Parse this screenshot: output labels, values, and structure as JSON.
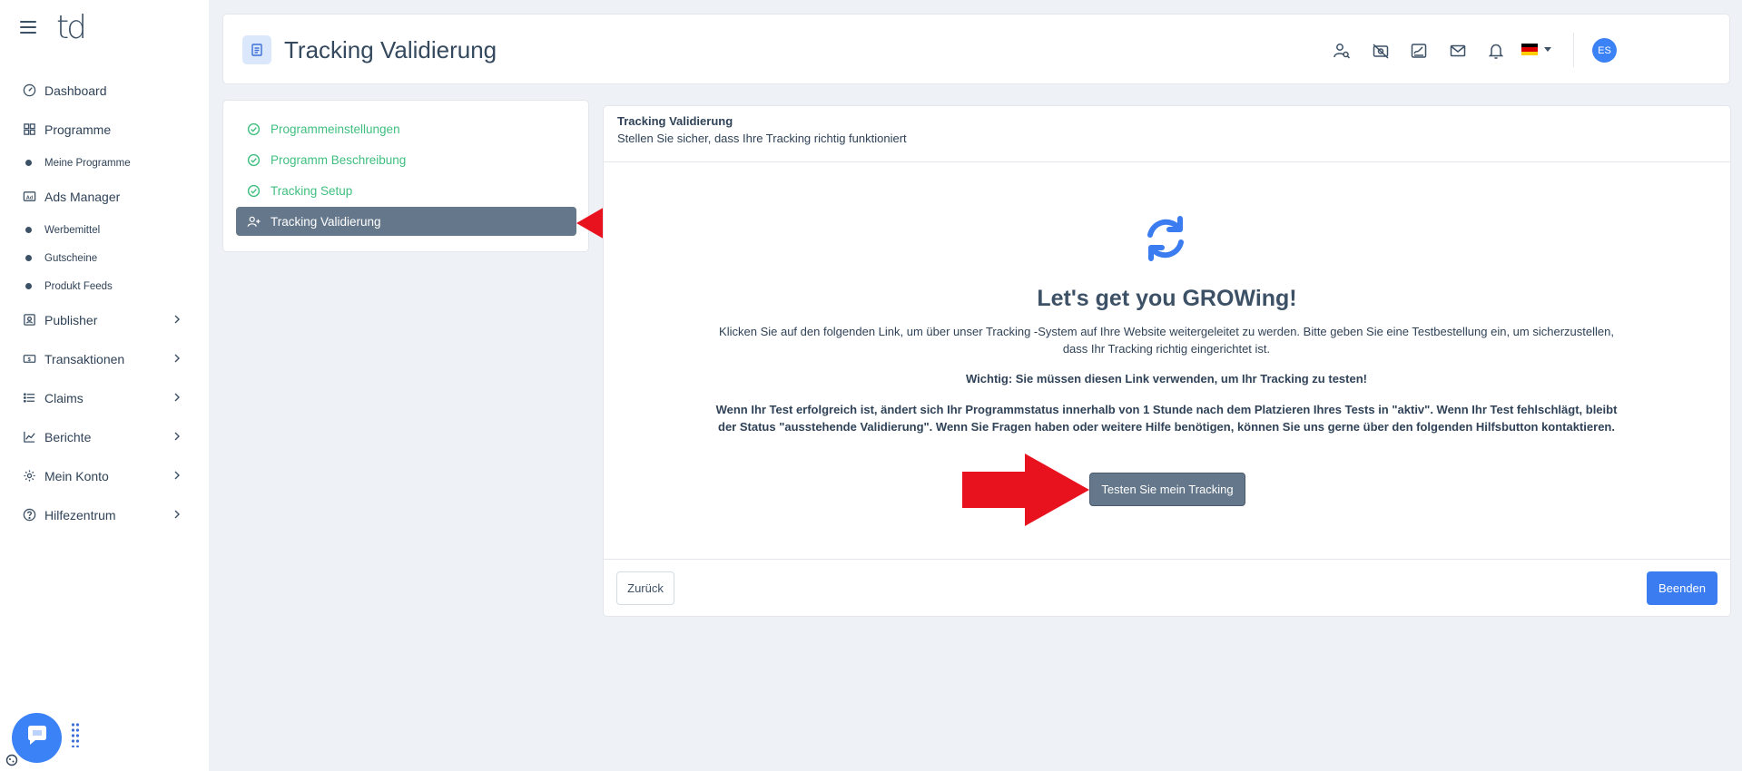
{
  "sidebar": {
    "logo": "td",
    "items": [
      {
        "label": "Dashboard"
      },
      {
        "label": "Programme"
      },
      {
        "label": "Meine Programme"
      },
      {
        "label": "Ads Manager"
      },
      {
        "label": "Werbemittel"
      },
      {
        "label": "Gutscheine"
      },
      {
        "label": "Produkt Feeds"
      },
      {
        "label": "Publisher"
      },
      {
        "label": "Transaktionen"
      },
      {
        "label": "Claims"
      },
      {
        "label": "Berichte"
      },
      {
        "label": "Mein Konto"
      },
      {
        "label": "Hilfezentrum"
      }
    ]
  },
  "header": {
    "title": "Tracking Validierung",
    "avatar_initials": "ES"
  },
  "steps": [
    {
      "label": "Programmeinstellungen",
      "state": "done"
    },
    {
      "label": "Programm Beschreibung",
      "state": "done"
    },
    {
      "label": "Tracking Setup",
      "state": "done"
    },
    {
      "label": "Tracking Validierung",
      "state": "active"
    }
  ],
  "card": {
    "title": "Tracking Validierung",
    "subtitle": "Stellen Sie sicher, dass Ihre Tracking richtig funktioniert",
    "headline": "Let's get you GROWing!",
    "intro": "Klicken Sie auf den folgenden Link, um über unser Tracking -System auf Ihre Website weitergeleitet zu werden. Bitte geben Sie eine Testbestellung ein, um sicherzustellen, dass Ihr Tracking richtig eingerichtet ist.",
    "important": "Wichtig: Sie müssen diesen Link verwenden, um Ihr Tracking zu testen!",
    "info": "Wenn Ihr Test erfolgreich ist, ändert sich Ihr Programmstatus innerhalb von 1 Stunde nach dem Platzieren Ihres Tests in \"aktiv\". Wenn Ihr Test fehlschlägt, bleibt der Status \"ausstehende Validierung\". Wenn Sie Fragen haben oder weitere Hilfe benötigen, können Sie uns gerne über den folgenden Hilfsbutton kontaktieren.",
    "test_button": "Testen Sie mein Tracking",
    "back_button": "Zurück",
    "finish_button": "Beenden"
  },
  "colors": {
    "accent": "#3b82f6",
    "success": "#3fbf7f",
    "active_step": "#65778a",
    "arrow": "#e8121f"
  }
}
